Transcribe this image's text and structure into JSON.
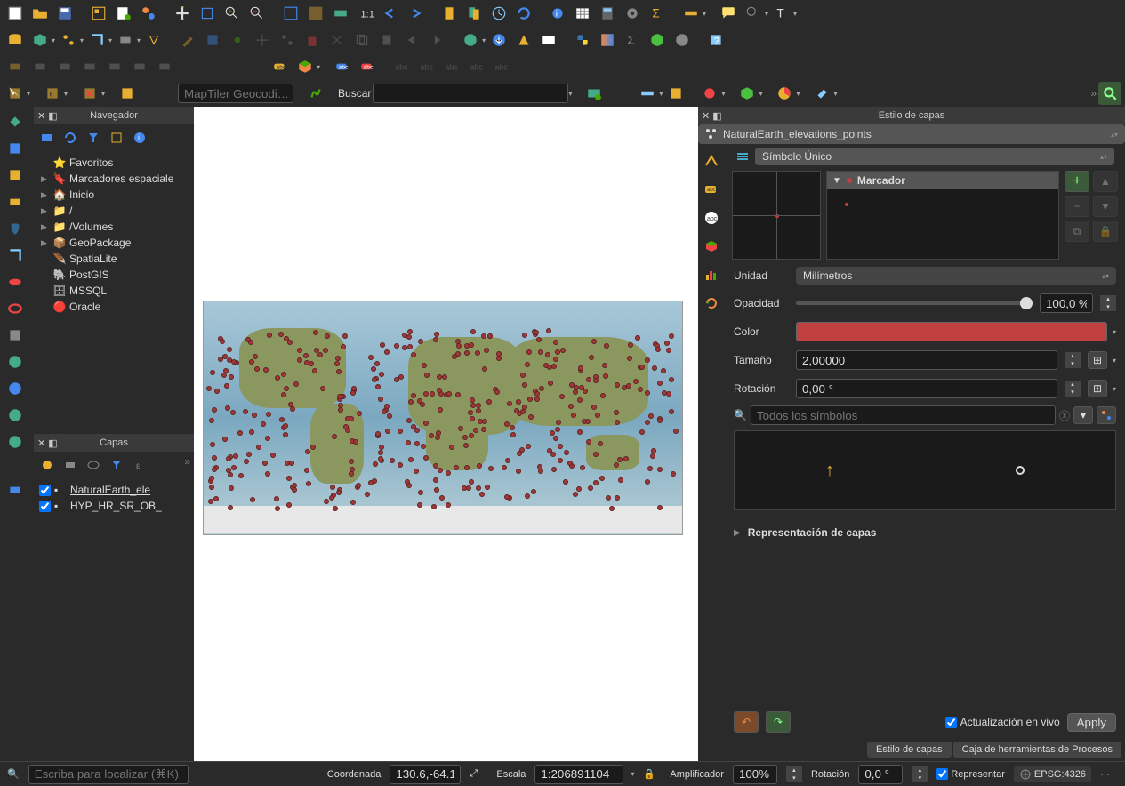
{
  "toolbar_row3": {
    "geocode_placeholder": "MapTiler Geocodi…",
    "search_label": "Buscar"
  },
  "navigator": {
    "title": "Navegador",
    "items": [
      {
        "label": "Favoritos",
        "arrow": "",
        "icon": "star"
      },
      {
        "label": "Marcadores espaciale",
        "arrow": "▶",
        "icon": "bookmark"
      },
      {
        "label": "Inicio",
        "arrow": "▶",
        "icon": "home"
      },
      {
        "label": "/",
        "arrow": "▶",
        "icon": "folder"
      },
      {
        "label": "/Volumes",
        "arrow": "▶",
        "icon": "folder"
      },
      {
        "label": "GeoPackage",
        "arrow": "▶",
        "icon": "geopackage"
      },
      {
        "label": "SpatiaLite",
        "arrow": "",
        "icon": "spatialite"
      },
      {
        "label": "PostGIS",
        "arrow": "",
        "icon": "postgis"
      },
      {
        "label": "MSSQL",
        "arrow": "",
        "icon": "mssql"
      },
      {
        "label": "Oracle",
        "arrow": "",
        "icon": "oracle"
      }
    ]
  },
  "layers": {
    "title": "Capas",
    "items": [
      {
        "label": "NaturalEarth_ele",
        "checked": true,
        "underline": true
      },
      {
        "label": "HYP_HR_SR_OB_",
        "checked": true,
        "underline": false
      }
    ]
  },
  "style": {
    "title": "Estilo de capas",
    "layer_name": "NaturalEarth_elevations_points",
    "symbol_type": "Símbolo Único",
    "marker_label": "Marcador",
    "unit_label": "Unidad",
    "unit_value": "Milímetros",
    "opacity_label": "Opacidad",
    "opacity_value": "100,0 %",
    "color_label": "Color",
    "color_value": "#c04040",
    "size_label": "Tamaño",
    "size_value": "2,00000",
    "rotation_label": "Rotación",
    "rotation_value": "0,00 °",
    "search_placeholder": "Todos los símbolos",
    "repr_label": "Representación de capas",
    "live_update_label": "Actualización en vivo",
    "apply_label": "Apply",
    "tab1": "Estilo de capas",
    "tab2": "Caja de herramientas de Procesos"
  },
  "status": {
    "locator_placeholder": "Escriba para localizar (⌘K)",
    "coord_label": "Coordenada",
    "coord_value": "130.6,-64.1",
    "scale_label": "Escala",
    "scale_value": "1:206891104",
    "mag_label": "Amplificador",
    "mag_value": "100%",
    "rot_label": "Rotación",
    "rot_value": "0,0 °",
    "render_label": "Representar",
    "crs_label": "EPSG:4326"
  }
}
